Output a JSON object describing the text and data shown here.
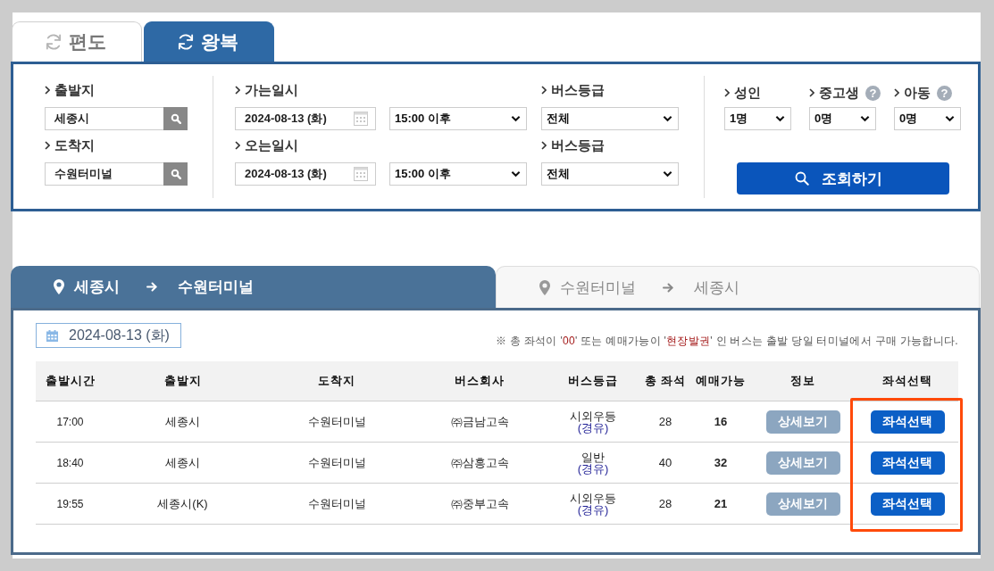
{
  "trip_tabs": [
    {
      "label": "편도",
      "selected": false
    },
    {
      "label": "왕복",
      "selected": true
    }
  ],
  "search": {
    "origin": {
      "label": "출발지",
      "value": "세종시"
    },
    "destination": {
      "label": "도착지",
      "value": "수원터미널"
    },
    "legs": [
      {
        "date_label": "가는일시",
        "date": "2024-08-13 (화)",
        "time": "15:00 이후",
        "grade_label": "버스등급",
        "grade": "전체"
      },
      {
        "date_label": "오는일시",
        "date": "2024-08-13 (화)",
        "time": "15:00 이후",
        "grade_label": "버스등급",
        "grade": "전체"
      }
    ],
    "passengers": [
      {
        "label": "성인",
        "value": "1명"
      },
      {
        "label": "중고생",
        "help": "?",
        "value": "0명"
      },
      {
        "label": "아동",
        "help": "?",
        "value": "0명"
      }
    ],
    "submit": "조회하기"
  },
  "route_tabs": [
    {
      "from": "세종시",
      "to": "수원터미널",
      "selected": true
    },
    {
      "from": "수원터미널",
      "to": "세종시",
      "selected": false
    }
  ],
  "results": {
    "date": "2024-08-13 (화)",
    "notice": [
      {
        "text": "※ 총 좌석이 '",
        "emphasis": false
      },
      {
        "text": "00",
        "emphasis": true
      },
      {
        "text": "' 또는 예매가능이 '",
        "emphasis": false
      },
      {
        "text": "현장발권",
        "emphasis": true
      },
      {
        "text": "' 인 버스는 출발 당일 터미널에서 구매 가능합니다.",
        "emphasis": false
      }
    ],
    "columns": [
      {
        "label": "출발시간",
        "highlighted": false
      },
      {
        "label": "출발지",
        "highlighted": false
      },
      {
        "label": "도착지",
        "highlighted": false
      },
      {
        "label": "버스회사",
        "highlighted": false
      },
      {
        "label": "버스등급",
        "highlighted": false
      },
      {
        "label": "총 좌석",
        "highlighted": false
      },
      {
        "label": "예매가능",
        "highlighted": false
      },
      {
        "label": "정보",
        "highlighted": false
      },
      {
        "label": "좌석선택",
        "highlighted": true
      }
    ],
    "rows": [
      {
        "time": "17:00",
        "origin": "세종시",
        "destination": "수원터미널",
        "company": "㈜금남고속",
        "grade": "시외우등",
        "via": "(경유)",
        "total_seats": "28",
        "available": "16",
        "detail_button": "상세보기",
        "select_button": "좌석선택"
      },
      {
        "time": "18:40",
        "origin": "세종시",
        "destination": "수원터미널",
        "company": "㈜삼흥고속",
        "grade": "일반",
        "via": "(경유)",
        "total_seats": "40",
        "available": "32",
        "detail_button": "상세보기",
        "select_button": "좌석선택"
      },
      {
        "time": "19:55",
        "origin": "세종시(K)",
        "destination": "수원터미널",
        "company": "㈜중부고속",
        "grade": "시외우등",
        "via": "(경유)",
        "total_seats": "28",
        "available": "21",
        "detail_button": "상세보기",
        "select_button": "좌석선택"
      }
    ]
  }
}
